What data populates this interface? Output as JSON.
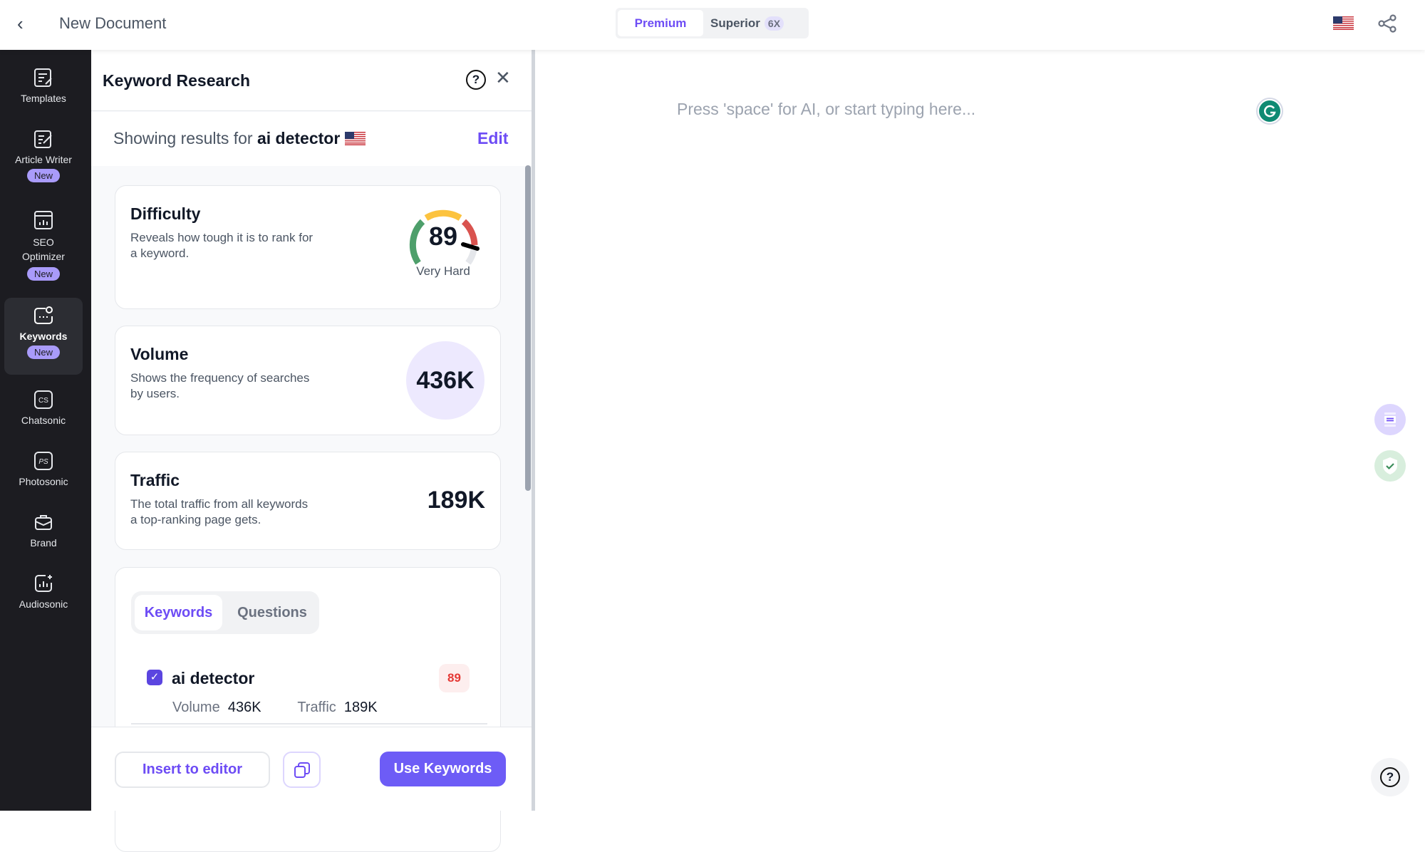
{
  "header": {
    "title": "New Document",
    "plans": [
      {
        "label": "Premium",
        "active": true
      },
      {
        "label": "Superior",
        "badge": "6X"
      }
    ]
  },
  "sidebar": {
    "items": [
      {
        "label": "Templates"
      },
      {
        "label": "Article Writer",
        "badge": "New"
      },
      {
        "label": "SEO Optimizer",
        "badge": "New"
      },
      {
        "label": "Keywords",
        "badge": "New",
        "active": true
      },
      {
        "label": "Chatsonic",
        "icon_text": "CS"
      },
      {
        "label": "Photosonic",
        "icon_text": "PS"
      },
      {
        "label": "Brand"
      },
      {
        "label": "Audiosonic"
      }
    ]
  },
  "panel": {
    "title": "Keyword Research",
    "showing_prefix": "Showing results for",
    "query": "ai detector",
    "edit_label": "Edit",
    "difficulty": {
      "title": "Difficulty",
      "desc": "Reveals how tough it is to rank for a keyword.",
      "value": "89",
      "label": "Very Hard"
    },
    "volume": {
      "title": "Volume",
      "desc": "Shows the frequency of searches by users.",
      "value": "436K"
    },
    "traffic": {
      "title": "Traffic",
      "desc": "The total traffic from all keywords a top-ranking page gets.",
      "value": "189K"
    },
    "tabs": [
      {
        "label": "Keywords",
        "active": true
      },
      {
        "label": "Questions"
      }
    ],
    "keywords": [
      {
        "keyword": "ai detector",
        "checked": true,
        "difficulty": "89",
        "volume_label": "Volume",
        "volume": "436K",
        "traffic_label": "Traffic",
        "traffic": "189K"
      }
    ],
    "footer": {
      "insert": "Insert to editor",
      "use": "Use Keywords"
    }
  },
  "editor": {
    "placeholder": "Press 'space' for AI, or start typing here..."
  },
  "colors": {
    "accent": "#6d4cf5",
    "sidebar": "#1c1c21",
    "hard": "#d9534f"
  }
}
